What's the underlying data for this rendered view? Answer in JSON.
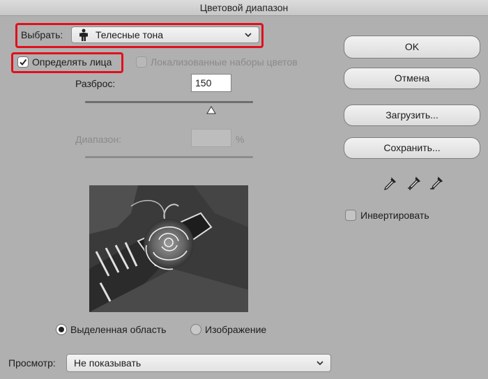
{
  "window": {
    "title": "Цветовой диапазон"
  },
  "select": {
    "label": "Выбрать:",
    "value": "Телесные тона",
    "value_icon": "person-icon"
  },
  "detect_faces": {
    "label": "Определять лица",
    "checked": true
  },
  "localized": {
    "label": "Локализованные наборы цветов",
    "checked": false,
    "enabled": false
  },
  "fuzziness": {
    "label": "Разброс:",
    "value": "150",
    "slider_fraction": 0.75
  },
  "range": {
    "label": "Диапазон:",
    "value": "",
    "unit": "%",
    "enabled": false
  },
  "buttons": {
    "ok": "OK",
    "cancel": "Отмена",
    "load": "Загрузить...",
    "save": "Сохранить..."
  },
  "eyedroppers": [
    "eyedropper-icon",
    "eyedropper-plus-icon",
    "eyedropper-minus-icon"
  ],
  "invert": {
    "label": "Инвертировать",
    "checked": false
  },
  "view_mode": {
    "selection_label": "Выделенная область",
    "image_label": "Изображение",
    "selected": "selection"
  },
  "preview_dropdown": {
    "label": "Просмотр:",
    "value": "Не показывать"
  },
  "colors": {
    "highlight": "#e0101d",
    "background": "#b0b0b0"
  }
}
